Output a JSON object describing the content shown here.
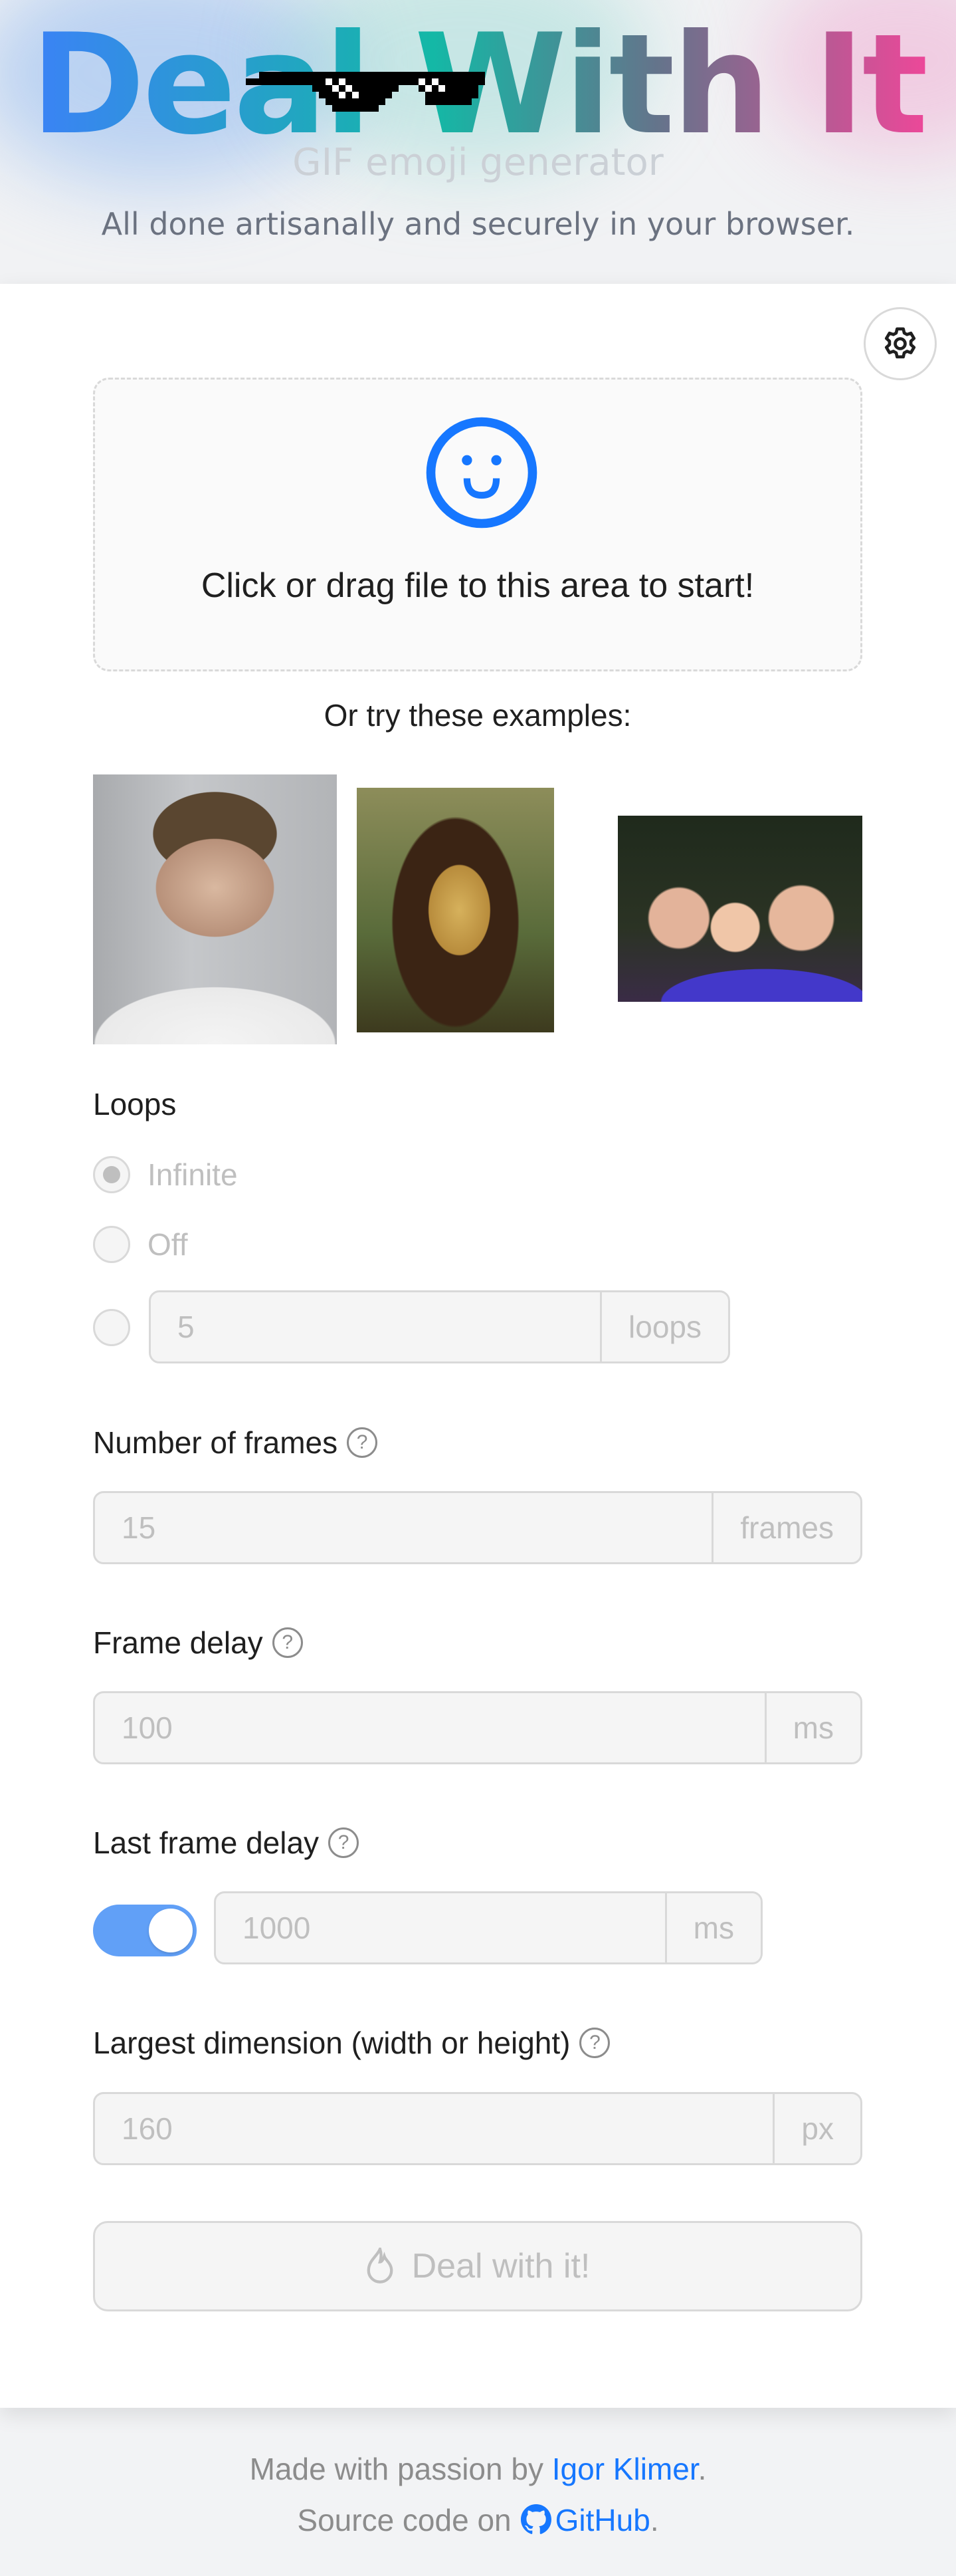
{
  "header": {
    "title": "Deal With It",
    "subtitle": "GIF emoji generator",
    "tagline": "All done artisanally and securely in your browser.",
    "title_gradient": [
      "#3b82f6",
      "#14b8a6",
      "#64748b",
      "#ec4899"
    ]
  },
  "settings": {
    "icon": "gear-icon",
    "label": "Settings"
  },
  "dropzone": {
    "icon": "smile-icon",
    "text": "Click or drag file to this area to start!",
    "icon_color": "#1677ff"
  },
  "examples": {
    "label": "Or try these examples:",
    "items": [
      {
        "alt": "Man with glasses portrait"
      },
      {
        "alt": "Mona Lisa"
      },
      {
        "alt": "Group of friends selfie"
      }
    ]
  },
  "loops": {
    "label": "Loops",
    "options": [
      {
        "label": "Infinite",
        "checked": true
      },
      {
        "label": "Off",
        "checked": false
      },
      {
        "label": "",
        "checked": false
      }
    ],
    "count_value": "5",
    "count_suffix": "loops"
  },
  "frames": {
    "label": "Number of frames",
    "value": "15",
    "suffix": "frames"
  },
  "frame_delay": {
    "label": "Frame delay",
    "value": "100",
    "suffix": "ms"
  },
  "last_frame_delay": {
    "label": "Last frame delay",
    "enabled": true,
    "value": "1000",
    "suffix": "ms"
  },
  "dimension": {
    "label": "Largest dimension (width or height)",
    "value": "160",
    "suffix": "px"
  },
  "help_glyph": "?",
  "submit": {
    "label": "Deal with it!",
    "icon": "fire-icon"
  },
  "footer": {
    "made_prefix": "Made with passion by ",
    "author": "Igor Klimer",
    "made_suffix": ".",
    "source_prefix": "Source code on",
    "github": "GitHub",
    "source_suffix": ".",
    "link_color": "#1677ff"
  }
}
